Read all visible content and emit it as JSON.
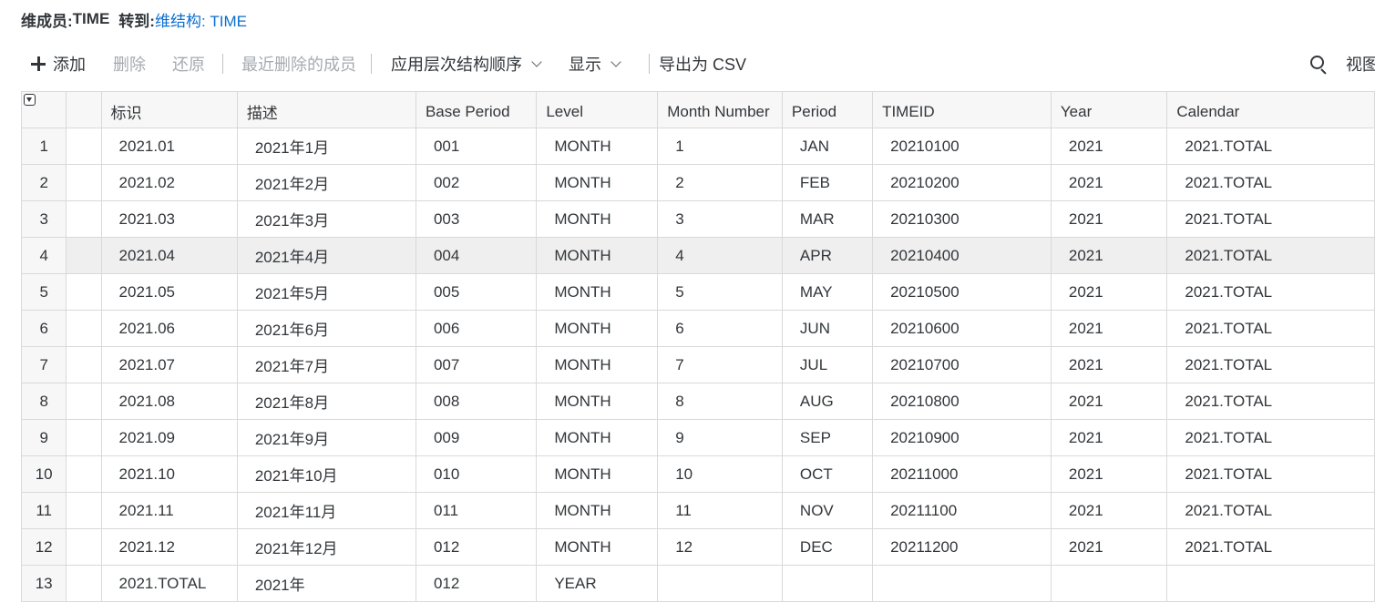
{
  "header": {
    "member_label": "维成员:",
    "member_value": "TIME",
    "goto_label": "转到:",
    "goto_link": "维结构: TIME"
  },
  "toolbar": {
    "add": "添加",
    "delete": "删除",
    "restore": "还原",
    "recently_deleted": "最近删除的成员",
    "apply_hierarchy": "应用层次结构顺序",
    "display": "显示",
    "export_csv": "导出为 CSV",
    "view": "视图"
  },
  "table": {
    "columns": [
      "标识",
      "描述",
      "Base Period",
      "Level",
      "Month Number",
      "Period",
      "TIMEID",
      "Year",
      "Calendar"
    ],
    "highlighted_row": 4,
    "rows": [
      {
        "num": "1",
        "cells": [
          "2021.01",
          "2021年1月",
          "001",
          "MONTH",
          "1",
          "JAN",
          "20210100",
          "2021",
          "2021.TOTAL"
        ]
      },
      {
        "num": "2",
        "cells": [
          "2021.02",
          "2021年2月",
          "002",
          "MONTH",
          "2",
          "FEB",
          "20210200",
          "2021",
          "2021.TOTAL"
        ]
      },
      {
        "num": "3",
        "cells": [
          "2021.03",
          "2021年3月",
          "003",
          "MONTH",
          "3",
          "MAR",
          "20210300",
          "2021",
          "2021.TOTAL"
        ]
      },
      {
        "num": "4",
        "cells": [
          "2021.04",
          "2021年4月",
          "004",
          "MONTH",
          "4",
          "APR",
          "20210400",
          "2021",
          "2021.TOTAL"
        ]
      },
      {
        "num": "5",
        "cells": [
          "2021.05",
          "2021年5月",
          "005",
          "MONTH",
          "5",
          "MAY",
          "20210500",
          "2021",
          "2021.TOTAL"
        ]
      },
      {
        "num": "6",
        "cells": [
          "2021.06",
          "2021年6月",
          "006",
          "MONTH",
          "6",
          "JUN",
          "20210600",
          "2021",
          "2021.TOTAL"
        ]
      },
      {
        "num": "7",
        "cells": [
          "2021.07",
          "2021年7月",
          "007",
          "MONTH",
          "7",
          "JUL",
          "20210700",
          "2021",
          "2021.TOTAL"
        ]
      },
      {
        "num": "8",
        "cells": [
          "2021.08",
          "2021年8月",
          "008",
          "MONTH",
          "8",
          "AUG",
          "20210800",
          "2021",
          "2021.TOTAL"
        ]
      },
      {
        "num": "9",
        "cells": [
          "2021.09",
          "2021年9月",
          "009",
          "MONTH",
          "9",
          "SEP",
          "20210900",
          "2021",
          "2021.TOTAL"
        ]
      },
      {
        "num": "10",
        "cells": [
          "2021.10",
          "2021年10月",
          "010",
          "MONTH",
          "10",
          "OCT",
          "20211000",
          "2021",
          "2021.TOTAL"
        ]
      },
      {
        "num": "11",
        "cells": [
          "2021.11",
          "2021年11月",
          "011",
          "MONTH",
          "11",
          "NOV",
          "20211100",
          "2021",
          "2021.TOTAL"
        ]
      },
      {
        "num": "12",
        "cells": [
          "2021.12",
          "2021年12月",
          "012",
          "MONTH",
          "12",
          "DEC",
          "20211200",
          "2021",
          "2021.TOTAL"
        ]
      },
      {
        "num": "13",
        "cells": [
          "2021.TOTAL",
          "2021年",
          "012",
          "YEAR",
          "",
          "",
          "",
          "",
          ""
        ]
      }
    ]
  }
}
